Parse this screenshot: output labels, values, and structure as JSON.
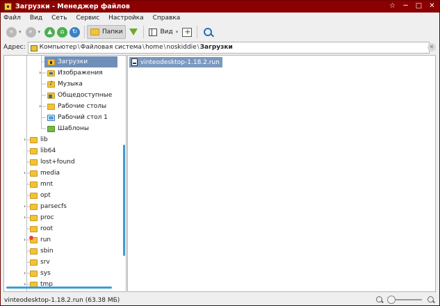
{
  "window": {
    "title": "Загрузки - Менеджер файлов",
    "controls": [
      "☆",
      "─",
      "□",
      "✕"
    ]
  },
  "menu": [
    "Файл",
    "Вид",
    "Сеть",
    "Сервис",
    "Настройка",
    "Справка"
  ],
  "toolbar": {
    "folders_label": "Папки",
    "view_label": "Вид"
  },
  "address": {
    "label": "Адрес:",
    "crumbs": [
      "Компьютер",
      "Файловая система",
      "home",
      "noskiddie",
      "Загрузки"
    ]
  },
  "tree": [
    {
      "label": "Загрузки",
      "icon": "download-folder-icon",
      "selected": true,
      "expander": false
    },
    {
      "label": "Изображения",
      "icon": "pictures-folder-icon",
      "expander": true
    },
    {
      "label": "Музыка",
      "icon": "music-folder-icon",
      "expander": false
    },
    {
      "label": "Общедоступные",
      "icon": "public-folder-icon",
      "expander": false
    },
    {
      "label": "Рабочие столы",
      "icon": "folder-icon",
      "expander": true
    },
    {
      "label": "Рабочий стол 1",
      "icon": "desktop-icon",
      "expander": false
    },
    {
      "label": "Шаблоны",
      "icon": "templates-folder-icon",
      "expander": false
    },
    {
      "label": "lib",
      "icon": "folder-icon",
      "expander": true
    },
    {
      "label": "lib64",
      "icon": "folder-icon",
      "expander": false
    },
    {
      "label": "lost+found",
      "icon": "folder-icon",
      "expander": false
    },
    {
      "label": "media",
      "icon": "folder-icon",
      "expander": true
    },
    {
      "label": "mnt",
      "icon": "folder-icon",
      "expander": false
    },
    {
      "label": "opt",
      "icon": "folder-icon",
      "expander": false
    },
    {
      "label": "parsecfs",
      "icon": "folder-icon",
      "expander": true
    },
    {
      "label": "proc",
      "icon": "folder-icon",
      "expander": true
    },
    {
      "label": "root",
      "icon": "folder-icon",
      "expander": false
    },
    {
      "label": "run",
      "icon": "run-folder-icon",
      "expander": true
    },
    {
      "label": "sbin",
      "icon": "folder-icon",
      "expander": false
    },
    {
      "label": "srv",
      "icon": "folder-icon",
      "expander": false
    },
    {
      "label": "sys",
      "icon": "folder-icon",
      "expander": true
    },
    {
      "label": "tmp",
      "icon": "folder-icon",
      "expander": true
    }
  ],
  "files": [
    {
      "name": "vinteodesktop-1.18.2.run",
      "selected": true
    }
  ],
  "status": {
    "text": "vinteodesktop-1.18.2.run (63.38 МБ)"
  },
  "colors": {
    "titlebar": "#8b0000",
    "selection": "#6f8fb8",
    "scrollbar": "#3d9bd6"
  }
}
